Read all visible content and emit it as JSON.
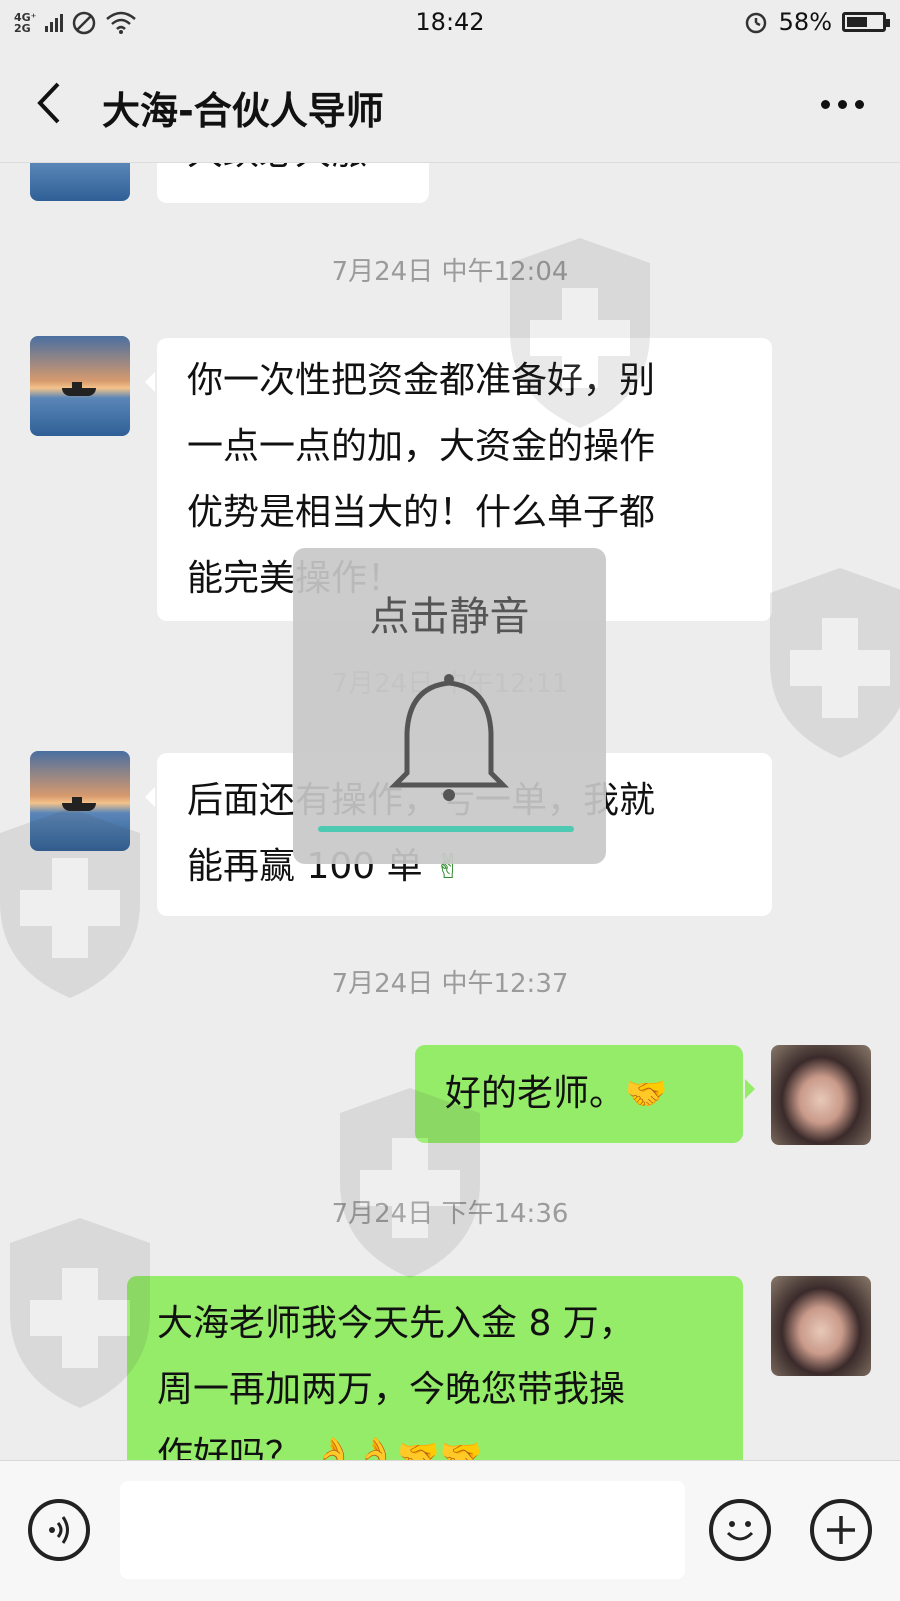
{
  "status_bar": {
    "network": "4G⁺\n2G",
    "time": "18:42",
    "battery_percent": "58%",
    "battery_level": 0.58
  },
  "header": {
    "title": "大海-合伙人导师"
  },
  "messages": {
    "partial_top": "大跌必大涨",
    "ts1": "7月24日 中午12:04",
    "msg1": [
      "你一次性把资金都准备好，别",
      "一点一点的加，大资金的操作",
      "优势是相当大的！什么单子都",
      "能完美操作！"
    ],
    "ts2": "7月24日 中午12:11",
    "msg2": [
      "后面还有操作，亏一单，我就",
      "能再赢 100 单"
    ],
    "msg2_emoji": "✌",
    "ts3": "7月24日 中午12:37",
    "msg3": "好的老师。",
    "msg3_emoji": "🤝",
    "ts4": "7月24日 下午14:36",
    "msg4": [
      "大海老师我今天先入金 8 万，",
      "周一再加两万，今晚您带我操",
      "作好吗？"
    ],
    "msg4_emoji": "👌👌🤝🤝"
  },
  "mute_overlay": {
    "label": "点击静音",
    "icon": "bell-icon"
  },
  "input_bar": {
    "placeholder": "",
    "voice_icon": "voice-icon",
    "emoji_icon": "smiley-icon",
    "plus_icon": "plus-icon"
  },
  "colors": {
    "outgoing_bubble": "#95ec69",
    "incoming_bubble": "#ffffff",
    "background": "#ededed",
    "accent": "#4ecab3"
  }
}
